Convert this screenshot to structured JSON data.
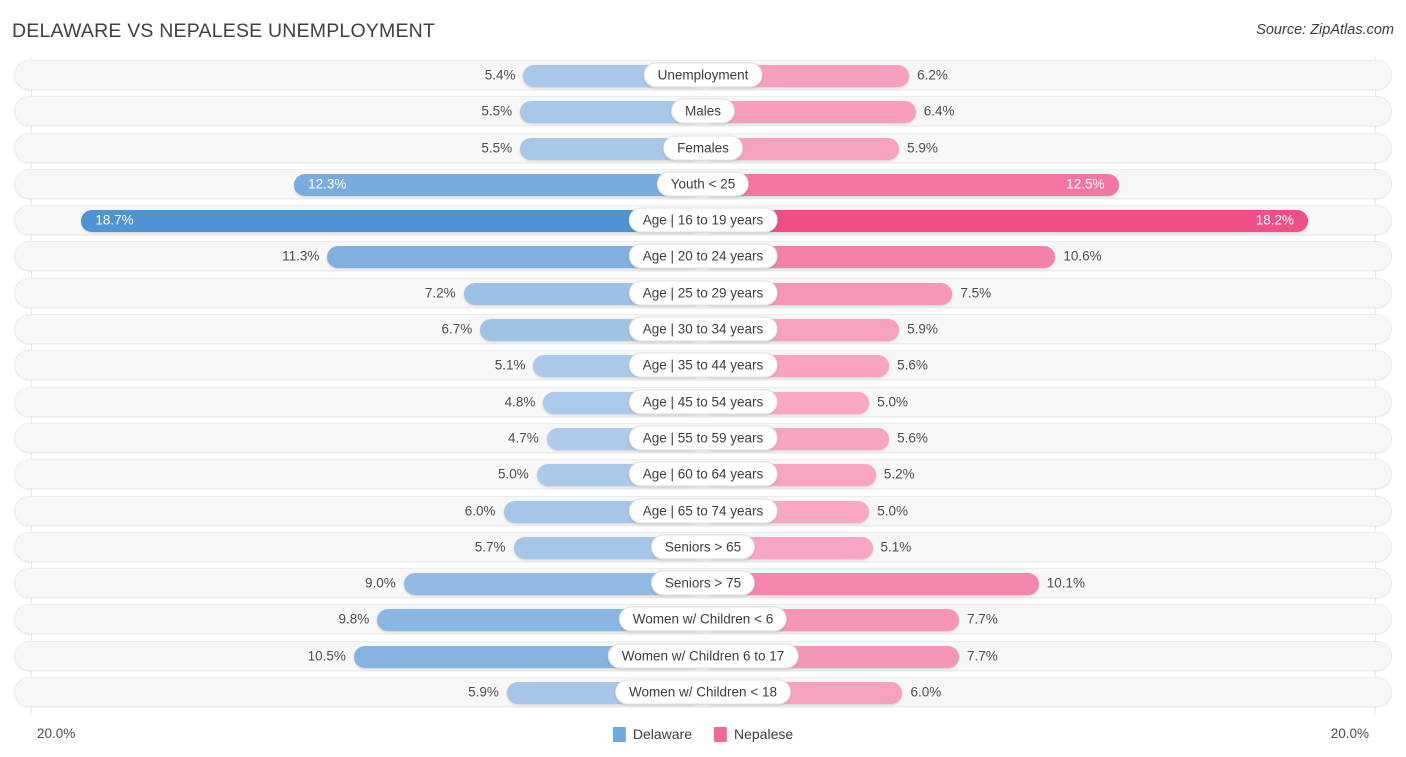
{
  "header": {
    "title": "DELAWARE VS NEPALESE UNEMPLOYMENT",
    "source": "Source: ZipAtlas.com"
  },
  "footer": {
    "axis_left": "20.0%",
    "axis_right": "20.0%",
    "legend": [
      {
        "label": "Delaware",
        "color": "#6CA9DD",
        "icon": "legend-swatch-blue"
      },
      {
        "label": "Nepalese",
        "color": "#F2679A",
        "icon": "legend-swatch-pink"
      }
    ]
  },
  "chart_data": {
    "type": "bar",
    "orientation": "horizontal-diverging",
    "title": "DELAWARE VS NEPALESE UNEMPLOYMENT",
    "xlabel": "",
    "ylabel": "",
    "axis_max": 20.0,
    "axis_unit": "%",
    "grid": true,
    "legend_position": "bottom-center",
    "series": [
      {
        "name": "Delaware",
        "side": "left",
        "color": "#6CA9DD",
        "values": [
          5.4,
          5.5,
          5.5,
          12.3,
          18.7,
          11.3,
          7.2,
          6.7,
          5.1,
          4.8,
          4.7,
          5.0,
          6.0,
          5.7,
          9.0,
          9.8,
          10.5,
          5.9
        ]
      },
      {
        "name": "Nepalese",
        "side": "right",
        "color": "#F2679A",
        "values": [
          6.2,
          6.4,
          5.9,
          12.5,
          18.2,
          10.6,
          7.5,
          5.9,
          5.6,
          5.0,
          5.6,
          5.2,
          5.0,
          5.1,
          10.1,
          7.7,
          7.7,
          6.0
        ]
      }
    ],
    "categories": [
      "Unemployment",
      "Males",
      "Females",
      "Youth < 25",
      "Age | 16 to 19 years",
      "Age | 20 to 24 years",
      "Age | 25 to 29 years",
      "Age | 30 to 34 years",
      "Age | 35 to 44 years",
      "Age | 45 to 54 years",
      "Age | 55 to 59 years",
      "Age | 60 to 64 years",
      "Age | 65 to 74 years",
      "Seniors > 65",
      "Seniors > 75",
      "Women w/ Children < 6",
      "Women w/ Children 6 to 17",
      "Women w/ Children < 18"
    ],
    "rows": [
      {
        "category": "Unemployment",
        "left_value": 5.4,
        "left_label": "5.4%",
        "right_value": 6.2,
        "right_label": "6.2%"
      },
      {
        "category": "Males",
        "left_value": 5.5,
        "left_label": "5.5%",
        "right_value": 6.4,
        "right_label": "6.4%"
      },
      {
        "category": "Females",
        "left_value": 5.5,
        "left_label": "5.5%",
        "right_value": 5.9,
        "right_label": "5.9%"
      },
      {
        "category": "Youth < 25",
        "left_value": 12.3,
        "left_label": "12.3%",
        "right_value": 12.5,
        "right_label": "12.5%"
      },
      {
        "category": "Age | 16 to 19 years",
        "left_value": 18.7,
        "left_label": "18.7%",
        "right_value": 18.2,
        "right_label": "18.2%"
      },
      {
        "category": "Age | 20 to 24 years",
        "left_value": 11.3,
        "left_label": "11.3%",
        "right_value": 10.6,
        "right_label": "10.6%"
      },
      {
        "category": "Age | 25 to 29 years",
        "left_value": 7.2,
        "left_label": "7.2%",
        "right_value": 7.5,
        "right_label": "7.5%"
      },
      {
        "category": "Age | 30 to 34 years",
        "left_value": 6.7,
        "left_label": "6.7%",
        "right_value": 5.9,
        "right_label": "5.9%"
      },
      {
        "category": "Age | 35 to 44 years",
        "left_value": 5.1,
        "left_label": "5.1%",
        "right_value": 5.6,
        "right_label": "5.6%"
      },
      {
        "category": "Age | 45 to 54 years",
        "left_value": 4.8,
        "left_label": "4.8%",
        "right_value": 5.0,
        "right_label": "5.0%"
      },
      {
        "category": "Age | 55 to 59 years",
        "left_value": 4.7,
        "left_label": "4.7%",
        "right_value": 5.6,
        "right_label": "5.6%"
      },
      {
        "category": "Age | 60 to 64 years",
        "left_value": 5.0,
        "left_label": "5.0%",
        "right_value": 5.2,
        "right_label": "5.2%"
      },
      {
        "category": "Age | 65 to 74 years",
        "left_value": 6.0,
        "left_label": "6.0%",
        "right_value": 5.0,
        "right_label": "5.0%"
      },
      {
        "category": "Seniors > 65",
        "left_value": 5.7,
        "left_label": "5.7%",
        "right_value": 5.1,
        "right_label": "5.1%"
      },
      {
        "category": "Seniors > 75",
        "left_value": 9.0,
        "left_label": "9.0%",
        "right_value": 10.1,
        "right_label": "10.1%"
      },
      {
        "category": "Women w/ Children < 6",
        "left_value": 9.8,
        "left_label": "9.8%",
        "right_value": 7.7,
        "right_label": "7.7%"
      },
      {
        "category": "Women w/ Children 6 to 17",
        "left_value": 10.5,
        "left_label": "10.5%",
        "right_value": 7.7,
        "right_label": "7.7%"
      },
      {
        "category": "Women w/ Children < 18",
        "left_value": 5.9,
        "left_label": "5.9%",
        "right_value": 6.0,
        "right_label": "6.0%"
      }
    ]
  }
}
